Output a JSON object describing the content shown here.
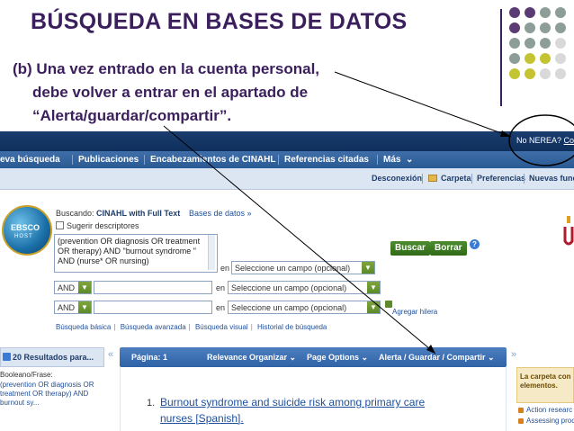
{
  "slide": {
    "title": "BÚSQUEDA EN BASES DE DATOS",
    "subtitle_lines": [
      "(b) Una vez entrado en la cuenta personal,",
      "debe volver a entrar en el apartado de",
      "“Alerta/guardar/compartir”."
    ],
    "decor_colors": [
      "#5b3b73",
      "#8c9e97",
      "#c4c432",
      "#d9d9d9"
    ]
  },
  "screenshot": {
    "user_status": "No NEREA?",
    "user_link": "Co",
    "nav": [
      "eva búsqueda",
      "Publicaciones",
      "Encabezamientos de CINAHL",
      "Referencias citadas",
      "Más"
    ],
    "toolbar": [
      "Desconexión",
      "Carpeta",
      "Preferencias",
      "Nuevas funci"
    ],
    "logo_text": "EBSCO",
    "logo_sub": "HOST",
    "searching_label": "Buscando:",
    "database": "CINAHL with Full Text",
    "databases_link": "Bases de datos »",
    "suggest_label": "Sugerir descriptores",
    "query": "(prevention OR diagnosis OR treatment OR therapy) AND \"burnout syndrome \" AND (nurse* OR nursing)",
    "en_label": "en",
    "field_placeholder_1": "Seleccione un campo (opcional)",
    "field_placeholder_2": "Seleccione un campo (opcional)",
    "field_placeholder_3": "Seleccione un campo (opcional)",
    "bool_1": "AND",
    "bool_2": "AND",
    "search_btn": "Buscar",
    "clear_btn": "Borrar",
    "help": "?",
    "add_row": "Agregar hilera",
    "links": [
      "Búsqueda básica",
      "Búsqueda avanzada",
      "Búsqueda visual",
      "Historial de búsqueda"
    ],
    "results_count": "20 Resultados para...",
    "boolean_label": "Booleano/Frase:",
    "boolean_text": "(prevention OR diagnosis OR treatment OR therapy) AND burnout sy...",
    "results_bar": {
      "page": "Página: 1",
      "relevance": "Relevance Organizar",
      "page_options": "Page Options",
      "alert": "Alerta / Guardar / Compartir"
    },
    "result_1": {
      "number": "1.",
      "title": "Burnout syndrome and suicide risk among primary care nurses [Spanish]."
    },
    "right_panel": {
      "text_1": "La carpeta con",
      "text_2": "elementos.",
      "link_1": "Action researc",
      "link_2": "Assessing proc"
    }
  }
}
